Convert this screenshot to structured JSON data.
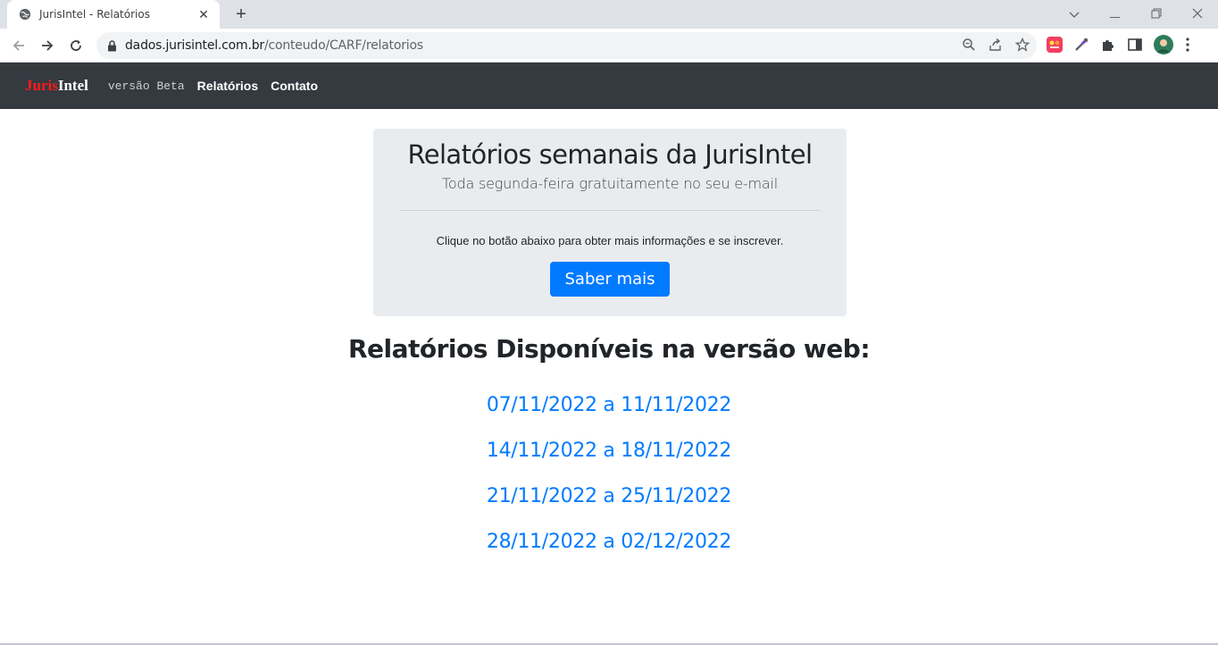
{
  "browser": {
    "tab_title": "JurisIntel - Relatórios",
    "url_host": "dados.jurisintel.com.br",
    "url_path": "/conteudo/CARF/relatorios",
    "newtab": "+",
    "tab_close": "✕"
  },
  "navbar": {
    "brand_juris": "Juris",
    "brand_intel": "Intel",
    "beta": "versão Beta",
    "links": [
      "Relatórios",
      "Contato"
    ]
  },
  "jumbotron": {
    "title": "Relatórios semanais da JurisIntel",
    "lead": "Toda segunda-feira gratuitamente no seu e-mail",
    "info": "Clique no botão abaixo para obter mais informações e se inscrever.",
    "button": "Saber mais"
  },
  "reports_section": {
    "title_prefix": "Relatórios Disponíveis na ",
    "title_bold": "versão web",
    "title_suffix": ":",
    "links": [
      "07/11/2022 a 11/11/2022",
      "14/11/2022 a 18/11/2022",
      "21/11/2022 a 25/11/2022",
      "28/11/2022 a 02/12/2022"
    ]
  },
  "colors": {
    "navbar_bg": "#343a40",
    "brand_red": "#ff1a1a",
    "link_blue": "#007bff",
    "jumbo_bg": "#e9ecef"
  }
}
